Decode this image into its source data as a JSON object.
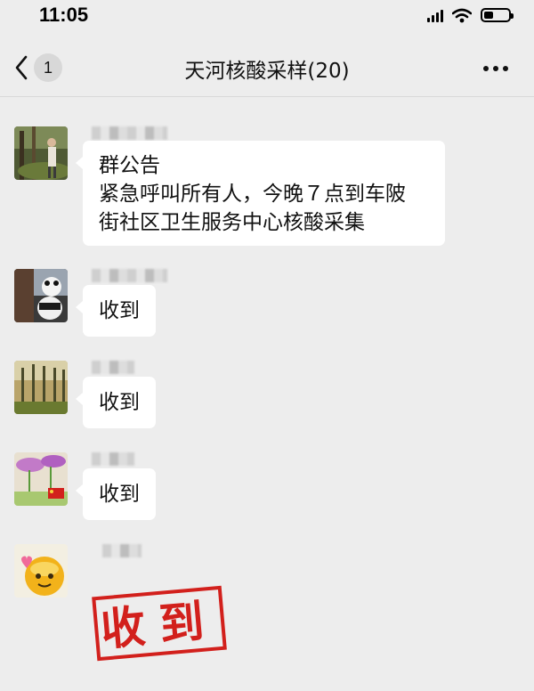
{
  "status_bar": {
    "time": "11:05",
    "battery_level": 0.4
  },
  "nav": {
    "back_icon": "chevron-left-icon",
    "back_count": "1",
    "title": "天河核酸采样(20)",
    "more_icon": "more-icon"
  },
  "messages": [
    {
      "text_lines": [
        "群公告",
        "紧急呼叫所有人，今晚７点到车陂",
        "街社区卫生服务中心核酸采集"
      ]
    },
    {
      "text": "收到"
    },
    {
      "text": "收到"
    },
    {
      "text": "收到"
    },
    {
      "sticker_text": "收到",
      "sticker_color": "#d2201c"
    }
  ]
}
